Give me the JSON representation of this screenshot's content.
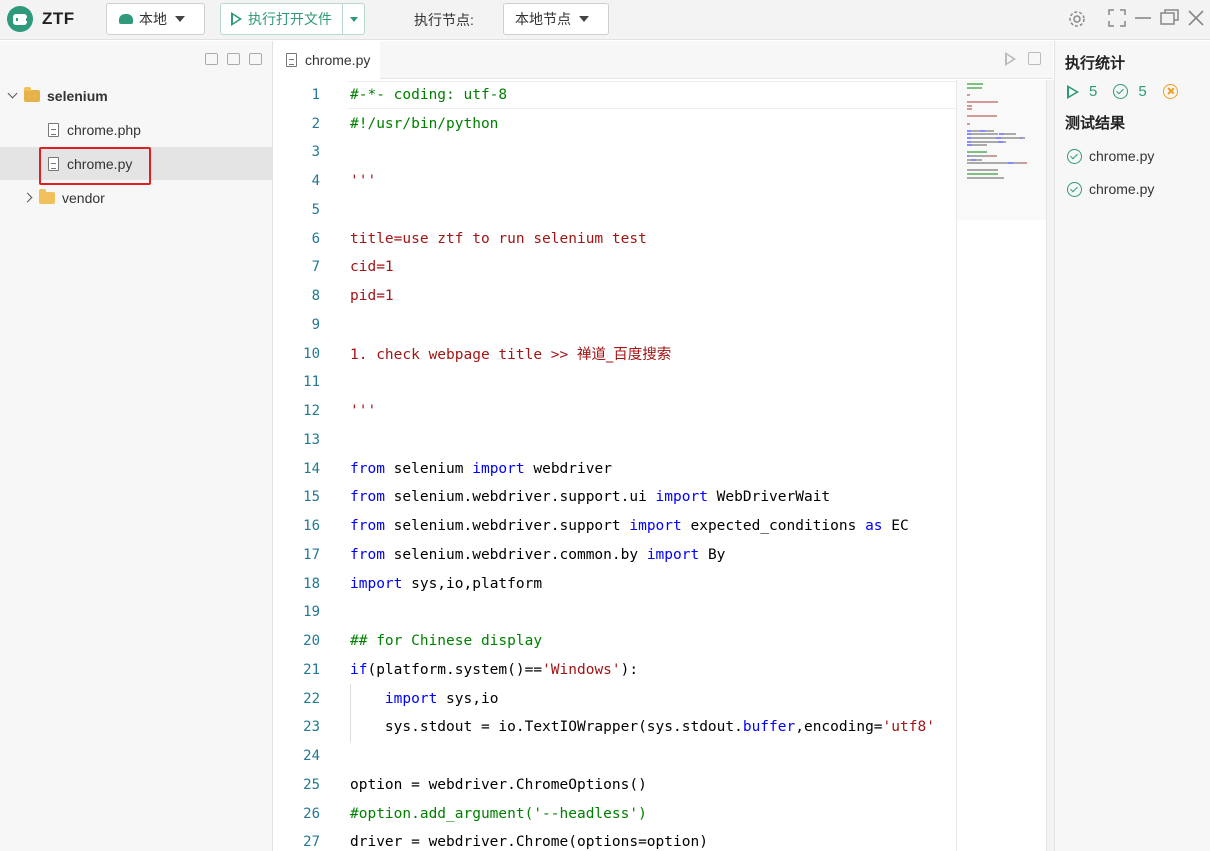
{
  "app": {
    "logo_text": "ZTF"
  },
  "toolbar": {
    "env_label": "本地",
    "run_label": "执行打开文件",
    "node_label": "执行节点:",
    "node_value": "本地节点"
  },
  "sidebar": {
    "tree": [
      {
        "label": "selenium",
        "type": "folder",
        "expanded": true,
        "depth": 0
      },
      {
        "label": "chrome.php",
        "type": "file",
        "depth": 1
      },
      {
        "label": "chrome.py",
        "type": "file",
        "depth": 1,
        "selected": true
      },
      {
        "label": "vendor",
        "type": "folder",
        "expanded": false,
        "depth": 0
      }
    ]
  },
  "editor": {
    "tab_label": "chrome.py",
    "lines": [
      {
        "n": "1",
        "tokens": [
          [
            "comment",
            "#-*- coding: utf-8"
          ]
        ]
      },
      {
        "n": "2",
        "tokens": [
          [
            "comment",
            "#!/usr/bin/python"
          ]
        ]
      },
      {
        "n": "3",
        "tokens": []
      },
      {
        "n": "4",
        "tokens": [
          [
            "string",
            "'''"
          ]
        ]
      },
      {
        "n": "5",
        "tokens": []
      },
      {
        "n": "6",
        "tokens": [
          [
            "string",
            "title=use ztf to run selenium test"
          ]
        ]
      },
      {
        "n": "7",
        "tokens": [
          [
            "string",
            "cid=1"
          ]
        ]
      },
      {
        "n": "8",
        "tokens": [
          [
            "string",
            "pid=1"
          ]
        ]
      },
      {
        "n": "9",
        "tokens": []
      },
      {
        "n": "10",
        "tokens": [
          [
            "string",
            "1. check webpage title >> "
          ],
          [
            "string-cjk",
            "禅道_百度搜索"
          ]
        ]
      },
      {
        "n": "11",
        "tokens": []
      },
      {
        "n": "12",
        "tokens": [
          [
            "string",
            "'''"
          ]
        ]
      },
      {
        "n": "13",
        "tokens": []
      },
      {
        "n": "14",
        "tokens": [
          [
            "keyword",
            "from"
          ],
          [
            "plain",
            " selenium "
          ],
          [
            "keyword",
            "import"
          ],
          [
            "plain",
            " webdriver"
          ]
        ]
      },
      {
        "n": "15",
        "tokens": [
          [
            "keyword",
            "from"
          ],
          [
            "plain",
            " selenium.webdriver.support.ui "
          ],
          [
            "keyword",
            "import"
          ],
          [
            "plain",
            " WebDriverWait"
          ]
        ]
      },
      {
        "n": "16",
        "tokens": [
          [
            "keyword",
            "from"
          ],
          [
            "plain",
            " selenium.webdriver.support "
          ],
          [
            "keyword",
            "import"
          ],
          [
            "plain",
            " expected_conditions "
          ],
          [
            "keyword",
            "as"
          ],
          [
            "plain",
            " EC"
          ]
        ]
      },
      {
        "n": "17",
        "tokens": [
          [
            "keyword",
            "from"
          ],
          [
            "plain",
            " selenium.webdriver.common.by "
          ],
          [
            "keyword",
            "import"
          ],
          [
            "plain",
            " By"
          ]
        ]
      },
      {
        "n": "18",
        "tokens": [
          [
            "keyword",
            "import"
          ],
          [
            "plain",
            " sys,io,platform"
          ]
        ]
      },
      {
        "n": "19",
        "tokens": []
      },
      {
        "n": "20",
        "tokens": [
          [
            "comment",
            "## for Chinese display"
          ]
        ]
      },
      {
        "n": "21",
        "tokens": [
          [
            "keyword",
            "if"
          ],
          [
            "plain",
            "(platform.system()=="
          ],
          [
            "string",
            "'Windows'"
          ],
          [
            "plain",
            "):"
          ]
        ]
      },
      {
        "n": "22",
        "tokens": [
          [
            "plain",
            "    "
          ],
          [
            "keyword",
            "import"
          ],
          [
            "plain",
            " sys,io"
          ]
        ]
      },
      {
        "n": "23",
        "tokens": [
          [
            "plain",
            "    sys.stdout = io.TextIOWrapper(sys.stdout."
          ],
          [
            "keyword",
            "buffer"
          ],
          [
            "plain",
            ",encoding="
          ],
          [
            "string",
            "'utf8'"
          ]
        ]
      },
      {
        "n": "24",
        "tokens": []
      },
      {
        "n": "25",
        "tokens": [
          [
            "plain",
            "option = webdriver.ChromeOptions()"
          ]
        ]
      },
      {
        "n": "26",
        "tokens": [
          [
            "comment",
            "#option.add_argument('--headless')"
          ]
        ]
      },
      {
        "n": "27",
        "tokens": [
          [
            "plain",
            "driver = webdriver.Chrome(options=option)"
          ]
        ]
      }
    ]
  },
  "results_panel": {
    "stats_title": "执行统计",
    "run_count": "5",
    "pass_count": "5",
    "results_title": "测试结果",
    "results": [
      "chrome.py",
      "chrome.py"
    ]
  },
  "colors": {
    "accent": "#2e9a7b",
    "comment": "#008000",
    "string": "#a31515",
    "keyword": "#0000ff",
    "line_number": "#237893",
    "selection_outline": "#e02020"
  }
}
